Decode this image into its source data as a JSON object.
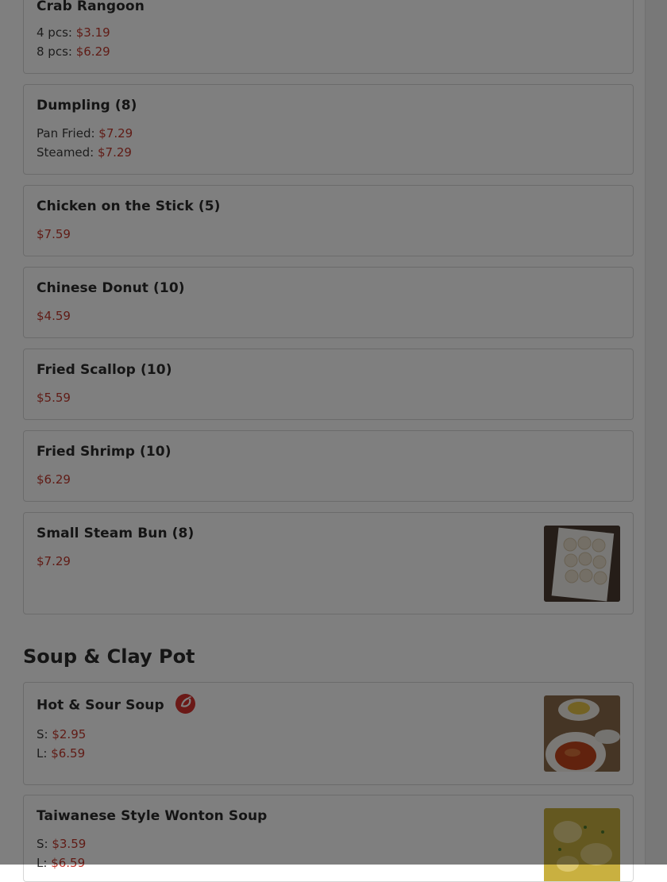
{
  "items": [
    {
      "name": "Crab Rangoon",
      "lines": [
        {
          "label": "4 pcs: ",
          "price": "$3.19"
        },
        {
          "label": "8 pcs: ",
          "price": "$6.29"
        }
      ]
    },
    {
      "name": "Dumpling (8)",
      "lines": [
        {
          "label": "Pan Fried: ",
          "price": "$7.29"
        },
        {
          "label": "Steamed: ",
          "price": "$7.29"
        }
      ]
    },
    {
      "name": "Chicken on the Stick (5)",
      "price": "$7.59"
    },
    {
      "name": "Chinese Donut (10)",
      "price": "$4.59"
    },
    {
      "name": "Fried Scallop (10)",
      "price": "$5.59"
    },
    {
      "name": "Fried Shrimp (10)",
      "price": "$6.29"
    },
    {
      "name": "Small Steam Bun (8)",
      "price": "$7.29"
    }
  ],
  "section_title": "Soup & Clay Pot",
  "soups": [
    {
      "name": "Hot & Sour Soup",
      "lines": [
        {
          "label": "S: ",
          "price": "$2.95"
        },
        {
          "label": "L: ",
          "price": "$6.59"
        }
      ]
    },
    {
      "name": "Taiwanese Style Wonton Soup",
      "lines": [
        {
          "label": "S: ",
          "price": "$3.59"
        },
        {
          "label": "L: ",
          "price": "$6.59"
        }
      ]
    }
  ],
  "icons": {
    "spicy": "chili-pepper-icon"
  },
  "colors": {
    "price": "#c1382d",
    "spicy_badge": "#d7332f",
    "overlay": "rgba(0,0,0,0.5)"
  }
}
